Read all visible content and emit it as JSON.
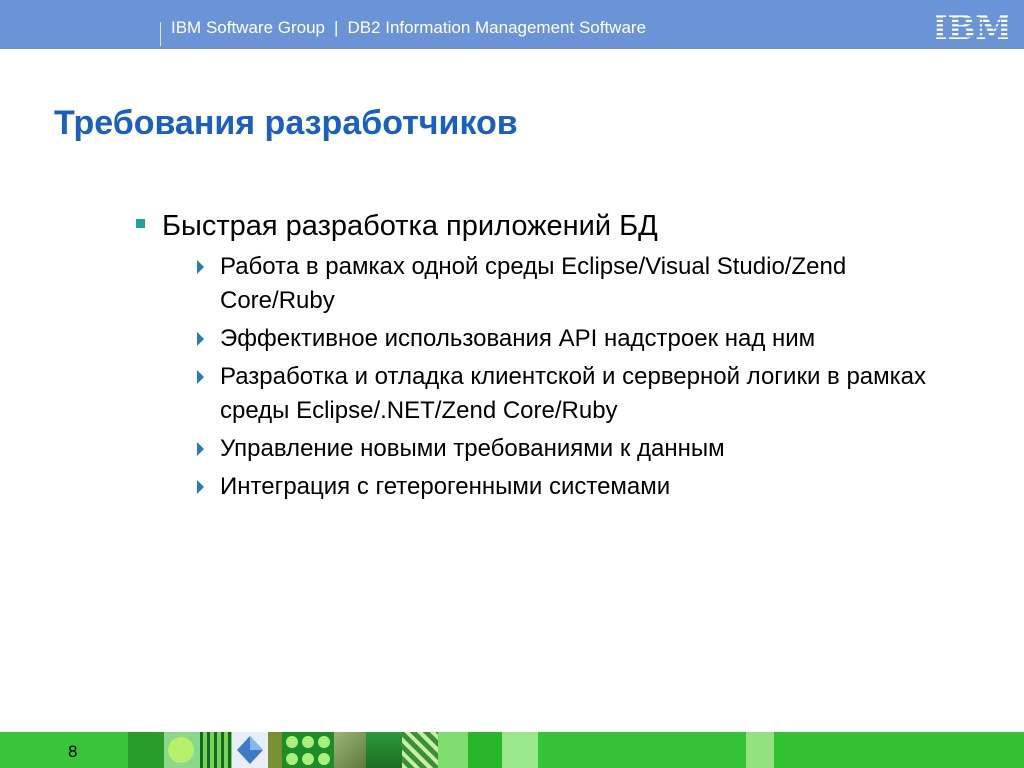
{
  "header": {
    "group": "IBM Software Group",
    "separator": "|",
    "product": "DB2 Information Management Software",
    "logo_text": "IBM"
  },
  "slide": {
    "title": "Требования разработчиков",
    "main_bullet": "Быстрая разработка приложений БД",
    "sub_bullets": [
      "Работа в рамках одной среды Eclipse/Visual Studio/Zend Core/Ruby",
      "Эффективное использования API надстроек над ним",
      "Разработка и отладка клиентской и серверной логики в рамках среды Eclipse/.NET/Zend Core/Ruby",
      "Управление новыми требованиями к данным",
      "Интеграция с гетерогенными системами"
    ]
  },
  "footer": {
    "page_number": "8"
  },
  "colors": {
    "header_bg": "#6a93d8",
    "title": "#1a5fc4",
    "bullet_square": "#21a19a",
    "bullet_triangle": "#2a7ab8",
    "footer_bg": "#2fbf2f"
  }
}
